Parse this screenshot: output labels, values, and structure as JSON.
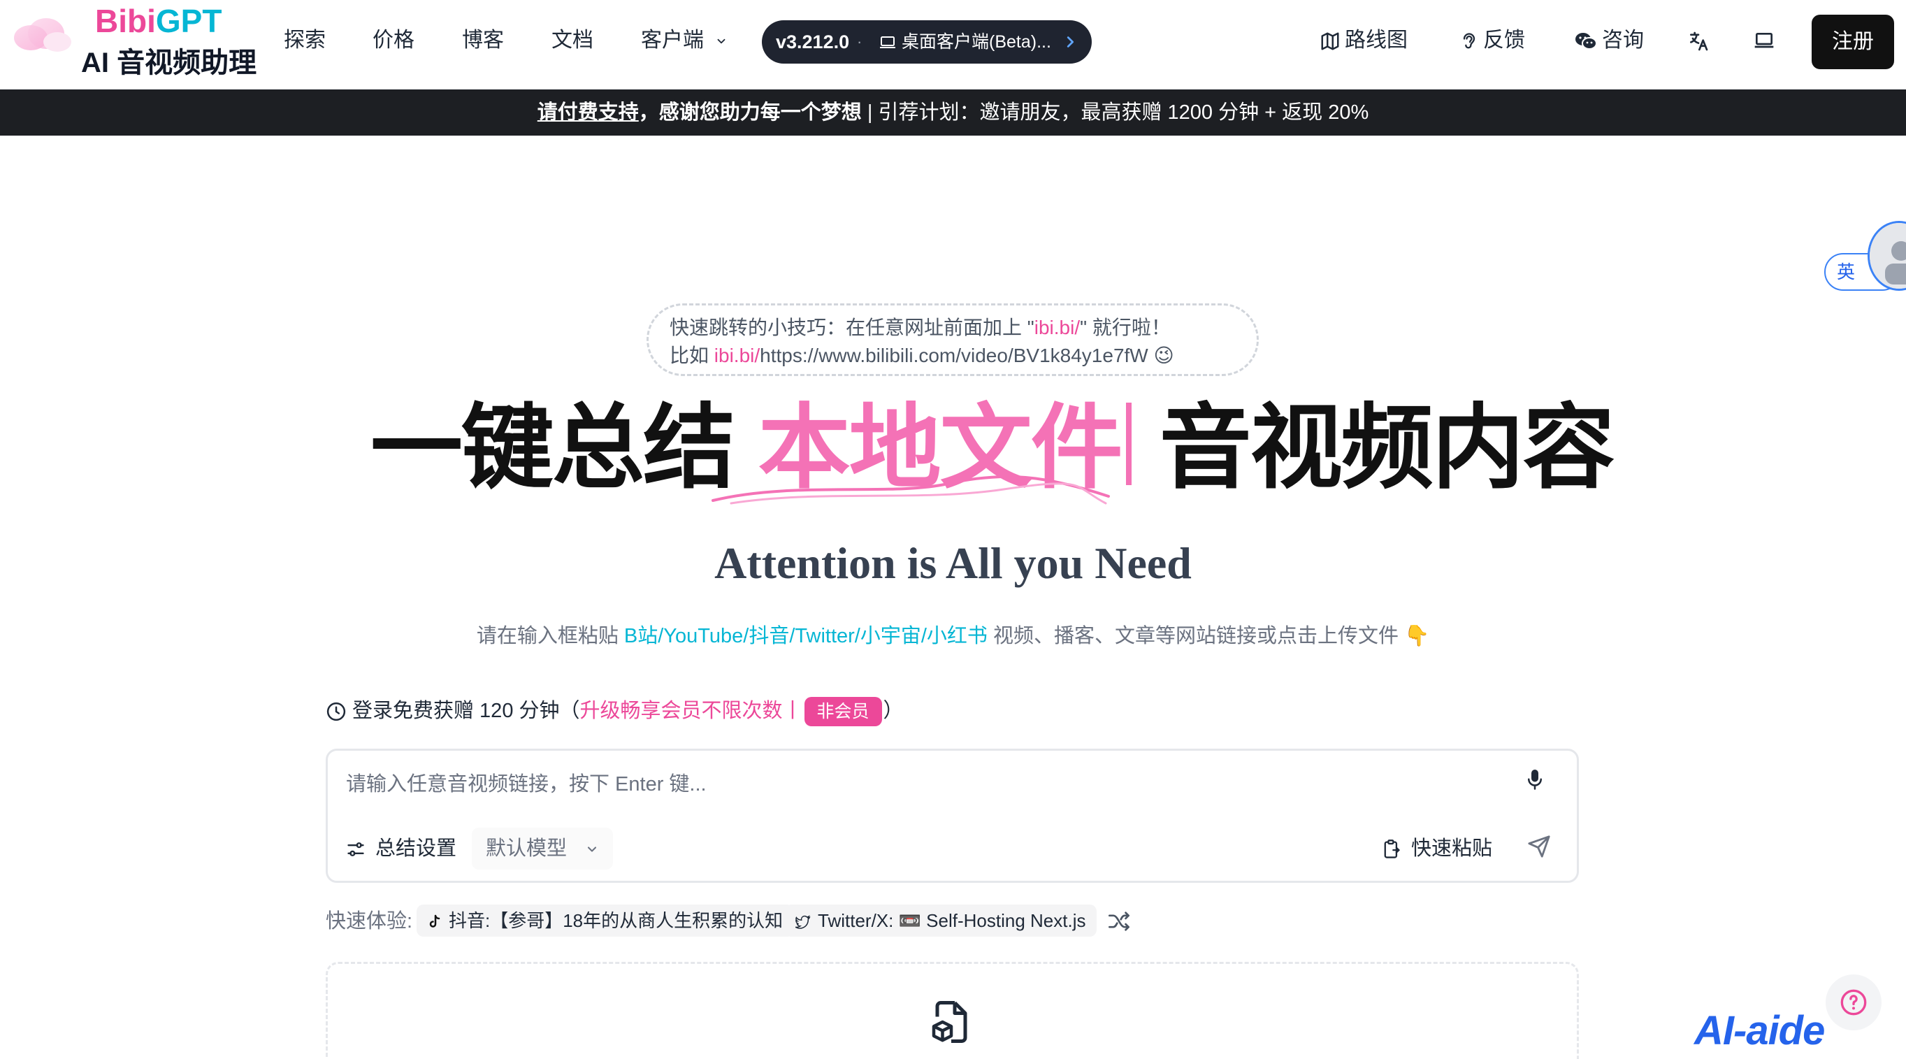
{
  "header": {
    "logo": {
      "part1": "Bibi",
      "part2": "GPT",
      "subtitle": "AI 音视频助理",
      "icon": "cloud-logo-icon"
    },
    "nav": [
      {
        "label": "探索"
      },
      {
        "label": "价格"
      },
      {
        "label": "博客"
      },
      {
        "label": "文档"
      },
      {
        "label": "客户端"
      }
    ],
    "version_pill": {
      "version": "v3.212.0",
      "separator": "·",
      "desktop_label": "桌面客户端(Beta)..."
    },
    "right_nav": [
      {
        "label": "路线图",
        "icon": "map-icon"
      },
      {
        "label": "反馈",
        "icon": "ear-icon"
      },
      {
        "label": "咨询",
        "icon": "wechat-icon"
      }
    ],
    "signup_label": "注册"
  },
  "banner": {
    "link_text": "请付费支持",
    "strong_text": "，感谢您助力每一个梦想",
    "separator": " | ",
    "referral_text": "引荐计划：邀请朋友，最高获赠 1200 分钟 + 返现 20%"
  },
  "float_widget": {
    "label": "英"
  },
  "tip": {
    "line1_prefix": "快速跳转的小技巧：在任意网址前面加上 \"",
    "line1_domain": "ibi.bi/",
    "line1_suffix": "\" 就行啦！",
    "line2_prefix": "比如 ",
    "line2_domain": "ibi.bi/",
    "line2_url": "https://www.bilibili.com/video/BV1k84y1e7fW",
    "emoji": "😉"
  },
  "hero": {
    "prefix": "一键总结 ",
    "accent": "本地文件",
    "suffix": "音视频内容"
  },
  "subtitle": "Attention is All you Need",
  "hint": {
    "prefix": "请在输入框粘贴 ",
    "platforms": "B站/YouTube/抖音/Twitter/小宇宙/小红书",
    "suffix": " 视频、播客、文章等网站链接或点击上传文件 ",
    "emoji": "👇"
  },
  "login_line": {
    "text": "登录免费获赠 120 分钟（",
    "upgrade": "升级畅享会员不限次数丨",
    "badge": "非会员",
    "close": "）"
  },
  "input": {
    "placeholder": "请输入任意音视频链接，按下 Enter 键...",
    "settings_label": "总结设置",
    "model_label": "默认模型",
    "paste_label": "快速粘贴"
  },
  "quick_try": {
    "label": "快速体验:",
    "chips": [
      {
        "text": "抖音:【参哥】18年的从商人生积累的认知",
        "icon": "tiktok-icon"
      },
      {
        "text": "Twitter/X: 📼 Self-Hosting Next.js",
        "icon": "twitter-icon"
      }
    ]
  },
  "watermark": "AI-aide",
  "colors": {
    "pink": "#ec4899",
    "cyan": "#06b6d4",
    "dark": "#1d1f23"
  }
}
